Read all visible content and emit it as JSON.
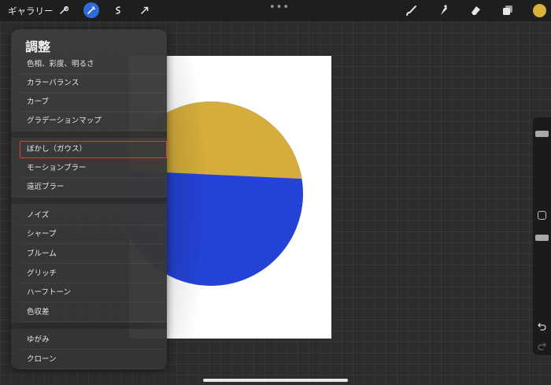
{
  "toolbar": {
    "gallery_label": "ギャラリー",
    "tools": [
      "wrench-icon",
      "magic-wand-icon",
      "selection-icon",
      "transform-icon"
    ],
    "right_tools": [
      "brush-icon",
      "smudge-icon",
      "eraser-icon",
      "layers-icon"
    ],
    "more_label": "•••",
    "current_color": "#d9b03a"
  },
  "adjustments": {
    "title": "調整",
    "groups": [
      [
        "色相、彩度、明るさ",
        "カラーバランス",
        "カーブ",
        "グラデーションマップ"
      ],
      [
        "ぼかし（ガウス）",
        "モーションブラー",
        "遠近ブラー"
      ],
      [
        "ノイズ",
        "シャープ",
        "ブルーム",
        "グリッチ",
        "ハーフトーン",
        "色収差"
      ],
      [
        "ゆがみ",
        "クローン"
      ]
    ],
    "selected_item": "ぼかし（ガウス）"
  },
  "artwork": {
    "top_color": "#d4ad3b",
    "bottom_color": "#2443d6"
  }
}
